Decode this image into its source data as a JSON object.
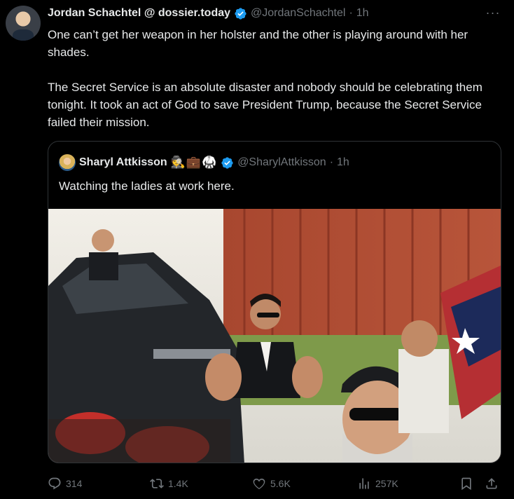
{
  "tweet": {
    "author_name": "Jordan Schachtel @ dossier.today",
    "handle": "@JordanSchachtel",
    "separator": "·",
    "time": "1h",
    "paragraph_1": "One can’t get her weapon in her holster and the other is playing around with her shades.",
    "paragraph_2": "The Secret Service is an absolute disaster and nobody should be celebrating them tonight. It took an act of God to save President Trump, because the Secret Service failed their mission."
  },
  "quote": {
    "author_name": "Sharyl Attkisson",
    "emojis": "🕵️💼🥋",
    "handle": "@SharylAttkisson",
    "separator": "·",
    "time": "1h",
    "text": "Watching the ladies at work here."
  },
  "actions": {
    "replies": "314",
    "reposts": "1.4K",
    "likes": "5.6K",
    "views": "257K"
  },
  "colors": {
    "background": "#000000",
    "text_primary": "#e7e9ea",
    "text_secondary": "#71767b",
    "verified_blue": "#1d9bf0",
    "border": "#2f3336"
  }
}
